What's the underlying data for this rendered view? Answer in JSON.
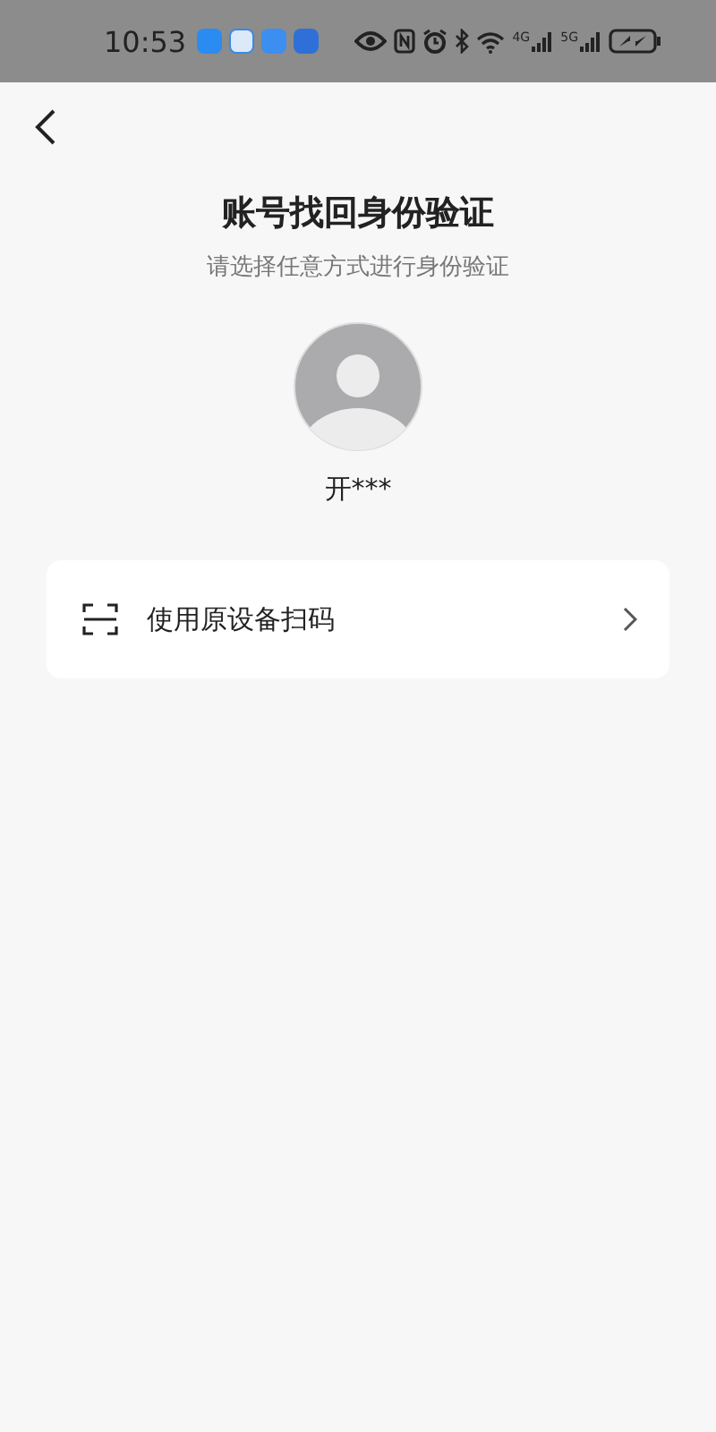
{
  "status_bar": {
    "time": "10:53",
    "network_1": "4G",
    "network_2": "5G"
  },
  "page": {
    "title": "账号找回身份验证",
    "subtitle": "请选择任意方式进行身份验证",
    "account_name": "开***"
  },
  "options": [
    {
      "kind": "scan",
      "label": "使用原设备扫码"
    }
  ]
}
